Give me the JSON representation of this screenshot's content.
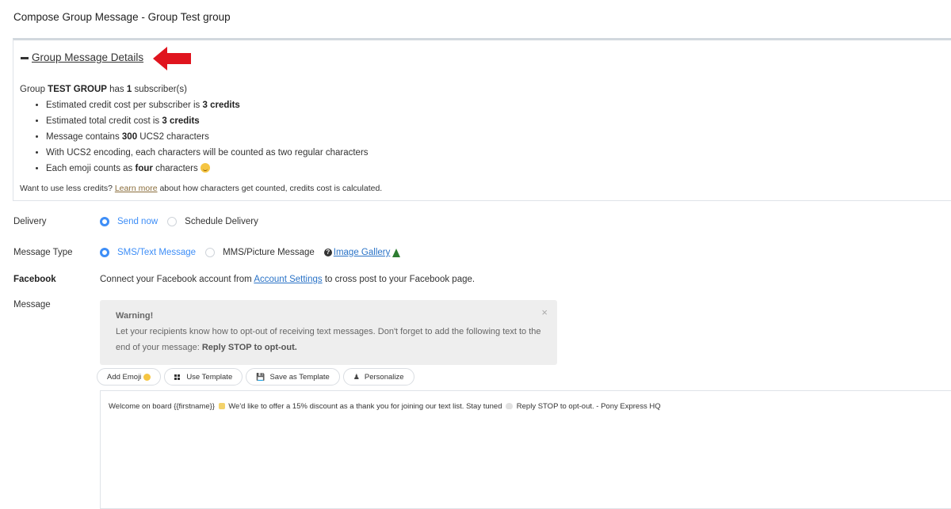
{
  "page_title": "Compose Group Message - Group Test group",
  "details": {
    "title": "Group Message Details",
    "group_prefix": "Group",
    "group_name": "TEST GROUP",
    "has_text": "has",
    "subscriber_count": "1",
    "subscriber_suffix": "subscriber(s)",
    "bullets": {
      "b1_text": "Estimated credit cost per subscriber is",
      "b1_bold": "3 credits",
      "b2_text": "Estimated total credit cost is",
      "b2_bold": "3 credits",
      "b3_pre": "Message contains",
      "b3_bold": "300",
      "b3_post": "UCS2 characters",
      "b4_text": "With UCS2 encoding, each characters will be counted as two regular characters",
      "b5_pre": "Each emoji counts as",
      "b5_bold": "four",
      "b5_post": "characters"
    },
    "hint_pre": "Want to use less credits?",
    "hint_link": "Learn more",
    "hint_post": "about how characters get counted, credits cost is calculated."
  },
  "delivery": {
    "label": "Delivery",
    "option_selected": "Send now",
    "option_other": "Schedule Delivery"
  },
  "message_type": {
    "label": "Message Type",
    "option_selected": "SMS/Text Message",
    "option_other": "MMS/Picture Message",
    "gallery_link": "Image Gallery"
  },
  "facebook": {
    "label": "Facebook",
    "text_pre": "Connect your Facebook account from",
    "link": "Account Settings",
    "text_post": "to cross post to your Facebook page."
  },
  "message": {
    "label": "Message",
    "warning_title": "Warning!",
    "warning_text": "Let your recipients know how to opt-out of receiving text messages. Don't forget to add the following text to the end of your message:",
    "warning_bold": "Reply STOP to opt-out.",
    "close_glyph": "×",
    "toolbar": {
      "add_emoji": "Add Emoji",
      "use_template": "Use Template",
      "save_template": "Save as Template",
      "personalize": "Personalize"
    },
    "body_part1": "Welcome on board {{firstname}}",
    "body_part2": "We'd like to offer a 15% discount as a thank you for joining our text list. Stay tuned",
    "body_part3": "Reply STOP to opt-out. - Pony Express HQ"
  },
  "colors": {
    "accent_blue": "#3e8ef7",
    "link_blue": "#2a73c7",
    "arrow_red": "#e0141e",
    "warning_bg": "#eeeeee"
  }
}
